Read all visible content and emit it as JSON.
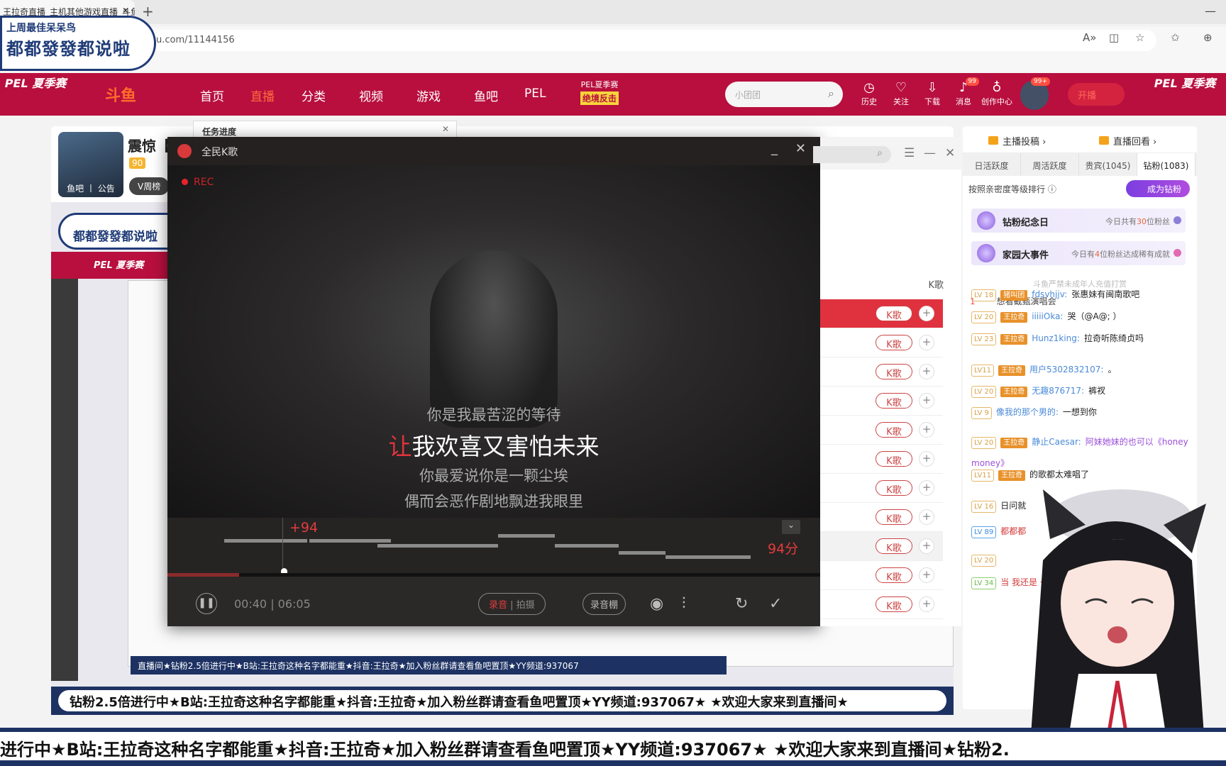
{
  "browser": {
    "tab_title": "王拉奇直播_主机其他游戏直播_斗鱼",
    "new_tab": "+",
    "url": "www.douyu.com/11144156",
    "url_visible": "u.com/11144156"
  },
  "overlay_badge": {
    "line1": "上周最佳呆呆鸟",
    "line2": "都都發發都说啦"
  },
  "nav": {
    "pel_left": "PEL 夏季赛",
    "logo": "斗鱼",
    "items": [
      "首页",
      "直播",
      "分类",
      "视频",
      "游戏",
      "鱼吧",
      "PEL"
    ],
    "active": "直播",
    "pel_summer": "PEL夏季赛",
    "pel_tag": "绝境反击",
    "search_placeholder": "小团团",
    "tools": [
      {
        "icon": "clock-icon",
        "label": "历史"
      },
      {
        "icon": "heart-icon",
        "label": "关注"
      },
      {
        "icon": "download-icon",
        "label": "下载"
      },
      {
        "icon": "bell-icon",
        "label": "消息",
        "badge": "99"
      },
      {
        "icon": "bulb-icon",
        "label": "创作中心"
      }
    ],
    "avatar_badge": "99+",
    "start_live": "开播",
    "pel_right": "PEL 夏季赛"
  },
  "room": {
    "title": "震惊【",
    "level": "90",
    "anchor_prefix": "王",
    "v_rank": "V周榜",
    "avatar_links": "鱼吧 丨 公告",
    "task_progress": "任务进度"
  },
  "karaoke": {
    "app_name": "全民K歌",
    "rec": "REC",
    "lyrics": {
      "prev": "你是我最苦涩的等待",
      "current_sung": "让",
      "current_rest": "我欢喜又害怕未来",
      "next1": "你最爱说你是一颗尘埃",
      "next2": "偶而会恶作剧地飘进我眼里"
    },
    "bonus": "+94",
    "score": "94分",
    "elapsed": "00:40",
    "total": "06:05",
    "progress": 0.11,
    "mode_record": "录音",
    "mode_video": "拍摄",
    "studio": "录音棚",
    "icons": [
      "pause-icon",
      "tuning-icon",
      "equalizer-icon",
      "repeat-icon",
      "finish-check-icon"
    ]
  },
  "song_list": {
    "column": "K歌",
    "button": "K歌",
    "add": "+",
    "row_count": 11
  },
  "chat": {
    "contribute": "主播投稿",
    "replay": "直播回看",
    "tabs": [
      "日活跃度",
      "周活跃度",
      "贵宾(1045)",
      "钻粉(1083)"
    ],
    "active_tab": "钻粉(1083)",
    "rank_note": "按照亲密度等级排行",
    "become_fan": "成为钻粉",
    "events": [
      {
        "title": "钻粉纪念日",
        "pre": "今日共有",
        "num": "30",
        "post": "位粉丝"
      },
      {
        "title": "家园大事件",
        "pre": "今日有",
        "num": "4",
        "post": "位粉丝达成稀有成就"
      }
    ],
    "minor_notice": "斗鱼严禁未成年人充值打赏",
    "top1": {
      "rank": "1",
      "name": "想看截甄演唱会"
    },
    "messages": [
      {
        "lv": "LV 18",
        "fan": "猪叫团",
        "user": "fdsvhjjv:",
        "text": "张惠妹有闽南歌吧"
      },
      {
        "lv": "LV 20",
        "fan": "王拉奇",
        "user": "iiiiiOka:",
        "text": "哭（@A@; ）"
      },
      {
        "lv": "LV 23",
        "fan": "王拉奇",
        "user": "Hunz1king:",
        "text": "拉奇听陈绮贞吗"
      },
      {
        "lv": "LV11",
        "fan": "王拉奇",
        "user": "用户5302832107:",
        "text": "。"
      },
      {
        "lv": "LV 20",
        "fan": "王拉奇",
        "user": "无趣876717:",
        "text": "裤衩"
      },
      {
        "lv": "LV 9",
        "fan": "",
        "user": "像我的那个男的:",
        "text": "一想到你"
      },
      {
        "lv": "LV 20",
        "fan": "王拉奇",
        "user": "静止Caesar:",
        "text": "阿妹她妹的也可以《honey money》",
        "style": "purple"
      },
      {
        "lv": "LV11",
        "fan": "王拉奇",
        "user": "",
        "text": "的歌都太难唱了"
      },
      {
        "lv": "LV 16",
        "fan": "",
        "user": "",
        "text": "日问就"
      },
      {
        "lv": "LV 89",
        "fan": "",
        "user": "",
        "text": "都都都",
        "style": "red"
      },
      {
        "lv": "LV 20",
        "fan": "",
        "user": "",
        "text": ""
      },
      {
        "lv": "LV 34",
        "fan": "",
        "user": "",
        "text": "当 我还是 一",
        "style": "red"
      }
    ]
  },
  "marquee": {
    "nested": "直播间★钻粉2.5倍进行中★B站:王拉奇这种名字都能重★抖音:王拉奇★加入粉丝群请查看鱼吧置顶★YY频道:937067",
    "mid": "钻粉2.5倍进行中★B站:王拉奇这种名字都能重★抖音:王拉奇★加入粉丝群请查看鱼吧置顶★YY频道:937067★ ★欢迎大家来到直播间★",
    "bottom": "进行中★B站:王拉奇这种名字都能重★抖音:王拉奇★加入粉丝群请查看鱼吧置顶★YY频道:937067★  ★欢迎大家来到直播间★钻粉2."
  },
  "colors": {
    "nav_red": "#b80f3e",
    "karaoke_red": "#e0313e",
    "marquee_navy": "#1d3263"
  }
}
